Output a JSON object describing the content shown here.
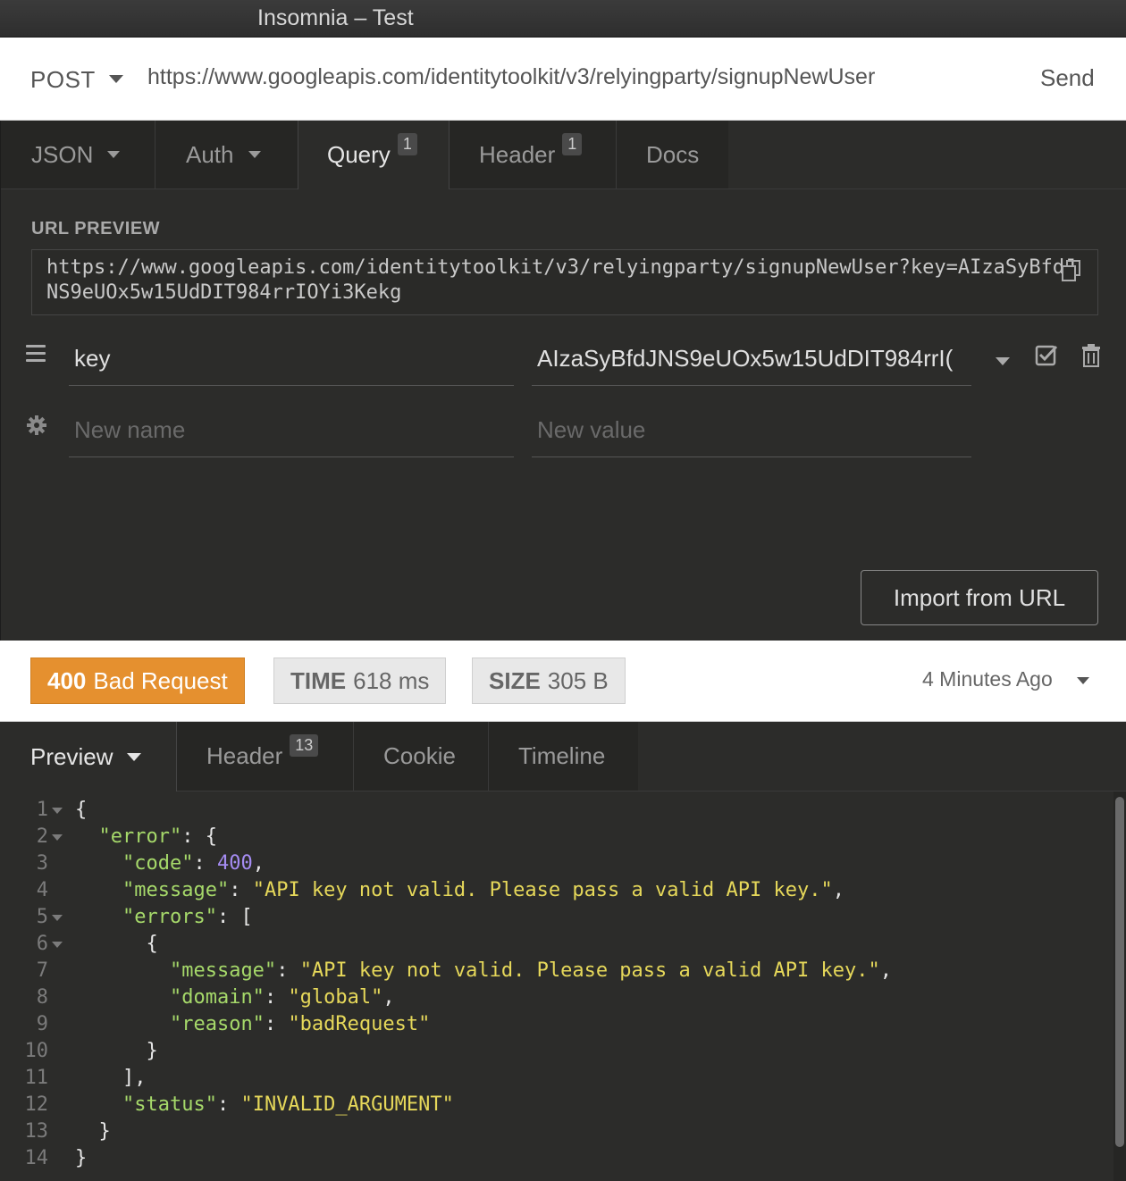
{
  "window": {
    "title": "Insomnia – Test"
  },
  "request": {
    "method": "POST",
    "url": "https://www.googleapis.com/identitytoolkit/v3/relyingparty/signupNewUser",
    "send_label": "Send"
  },
  "req_tabs": [
    {
      "label": "JSON"
    },
    {
      "label": "Auth"
    },
    {
      "label": "Query",
      "badge": "1"
    },
    {
      "label": "Header",
      "badge": "1"
    },
    {
      "label": "Docs"
    }
  ],
  "query": {
    "preview_label": "URL PREVIEW",
    "preview_url": "https://www.googleapis.com/identitytoolkit/v3/relyingparty/signupNewUser?key=AIzaSyBfdJNS9eUOx5w15UdDIT984rrIOYi3Kekg",
    "params": [
      {
        "name": "key",
        "value": "AIzaSyBfdJNS9eUOx5w15UdDIT984rrI("
      }
    ],
    "new_name_placeholder": "New name",
    "new_value_placeholder": "New value",
    "import_label": "Import from URL"
  },
  "response": {
    "status_code": "400",
    "status_text": "Bad Request",
    "time_label": "TIME",
    "time_value": "618 ms",
    "size_label": "SIZE",
    "size_value": "305 B",
    "time_ago": "4 Minutes Ago"
  },
  "resp_tabs": [
    {
      "label": "Preview"
    },
    {
      "label": "Header",
      "badge": "13"
    },
    {
      "label": "Cookie"
    },
    {
      "label": "Timeline"
    }
  ],
  "code_lines": [
    {
      "n": "1",
      "text": "{"
    },
    {
      "n": "2",
      "text": "  \"error\": {"
    },
    {
      "n": "3",
      "text": "    \"code\": 400,"
    },
    {
      "n": "4",
      "text": "    \"message\": \"API key not valid. Please pass a valid API key.\","
    },
    {
      "n": "5",
      "text": "    \"errors\": ["
    },
    {
      "n": "6",
      "text": "      {"
    },
    {
      "n": "7",
      "text": "        \"message\": \"API key not valid. Please pass a valid API key.\","
    },
    {
      "n": "8",
      "text": "        \"domain\": \"global\","
    },
    {
      "n": "9",
      "text": "        \"reason\": \"badRequest\""
    },
    {
      "n": "10",
      "text": "      }"
    },
    {
      "n": "11",
      "text": "    ],"
    },
    {
      "n": "12",
      "text": "    \"status\": \"INVALID_ARGUMENT\""
    },
    {
      "n": "13",
      "text": "  }"
    },
    {
      "n": "14",
      "text": "}"
    }
  ],
  "colors": {
    "status_error": "#e5902f",
    "json_key": "#a6d96a",
    "json_string": "#e6d85a",
    "json_number": "#a58cf2"
  }
}
